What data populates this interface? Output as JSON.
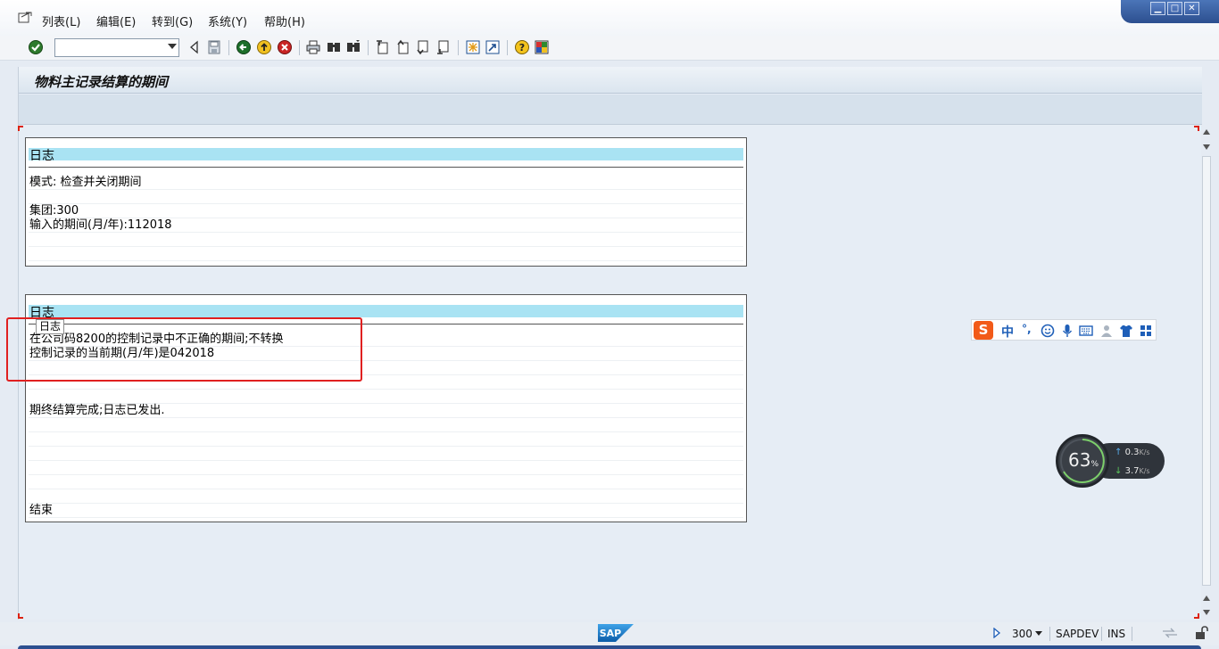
{
  "menu": {
    "items": [
      "列表(L)",
      "编辑(E)",
      "转到(G)",
      "系统(Y)",
      "帮助(H)"
    ]
  },
  "window_controls": {
    "minimize": "▁",
    "maximize": "□",
    "close": "✕"
  },
  "toolbar": {
    "command_value": "",
    "icons": [
      "enter-check-icon",
      "back-icon",
      "save-icon",
      "back-green-icon",
      "exit-yellow-icon",
      "cancel-red-icon",
      "print-icon",
      "find-icon",
      "find-next-icon",
      "first-page-icon",
      "prev-page-icon",
      "next-page-icon",
      "last-page-icon",
      "create-session-icon",
      "shortcut-icon",
      "help-icon",
      "customize-layout-icon"
    ]
  },
  "screen": {
    "title": "物料主记录结算的期间"
  },
  "log1": {
    "header": "日志",
    "lines": [
      "模式: 检查并关闭期间",
      "",
      "集团:300",
      "输入的期间(月/年):112018",
      "",
      ""
    ]
  },
  "log2": {
    "header": "日志",
    "lines": [
      "在公司码8200的控制记录中不正确的期间;不转换",
      "控制记录的当前期(月/年)是042018",
      "",
      "",
      "",
      "期终结算完成;日志已发出.",
      "",
      "",
      "",
      "",
      "",
      "",
      "结束"
    ]
  },
  "tooltip": "日志",
  "ime": {
    "logo": "S",
    "mode": "中",
    "punct": "°,",
    "icons": [
      "smiley-icon",
      "microphone-icon",
      "keyboard-icon",
      "user-icon",
      "shirt-icon",
      "grid-icon"
    ]
  },
  "netmon": {
    "percent": "63",
    "percent_unit": "%",
    "up": "0.3",
    "down": "3.7",
    "rate_unit": "K/s"
  },
  "status": {
    "client": "300",
    "system": "SAPDEV",
    "mode": "INS"
  },
  "colors": {
    "accent": "#2c4f8f",
    "log_header": "#a9e3f3",
    "highlight": "#e02020"
  }
}
